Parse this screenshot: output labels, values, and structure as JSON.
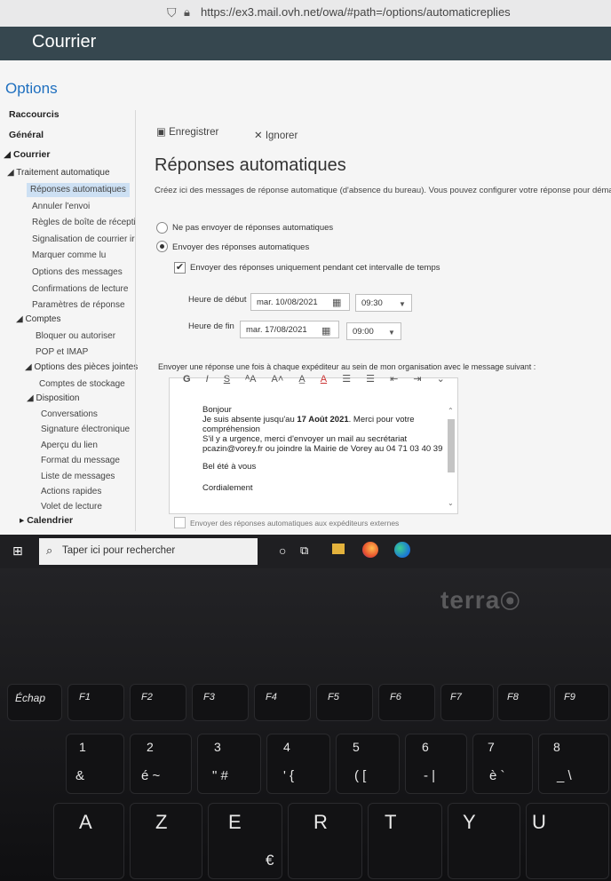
{
  "browser": {
    "url": "https://ex3.mail.ovh.net/owa/#path=/options/automaticreplies"
  },
  "header": {
    "app": "Courrier"
  },
  "options": {
    "title": "Options"
  },
  "nav": {
    "raccourcis": "Raccourcis",
    "general": "Général",
    "courrier": "Courrier",
    "traitement": "Traitement automatique",
    "reponses": "Réponses automatiques",
    "annuler": "Annuler l'envoi",
    "regles": "Règles de boîte de récepti",
    "signalisation": "Signalisation de courrier ir",
    "marquer": "Marquer comme lu",
    "options_messages": "Options des messages",
    "confirmations": "Confirmations de lecture",
    "parametres": "Paramètres de réponse",
    "comptes": "Comptes",
    "bloquer": "Bloquer ou autoriser",
    "pop": "POP et IMAP",
    "pieces": "Options des pièces jointes",
    "stockage": "Comptes de stockage",
    "disposition": "Disposition",
    "conversations": "Conversations",
    "signature": "Signature électronique",
    "apercu": "Aperçu du lien",
    "format": "Format du message",
    "liste": "Liste de messages",
    "actions": "Actions rapides",
    "volet": "Volet de lecture",
    "calendrier": "Calendrier"
  },
  "toolbar": {
    "save": "Enregistrer",
    "discard": "Ignorer"
  },
  "content": {
    "title": "Réponses automatiques",
    "intro": "Créez ici des messages de réponse automatique (d'absence du bureau). Vous pouvez configurer votre réponse pour déma",
    "radio_off": "Ne pas envoyer de réponses automatiques",
    "radio_on": "Envoyer des réponses automatiques",
    "interval": "Envoyer des réponses uniquement pendant cet intervalle de temps",
    "start_label": "Heure de début",
    "start_date": "mar. 10/08/2021",
    "start_time": "09:30",
    "end_label": "Heure de fin",
    "end_date": "mar. 17/08/2021",
    "end_time": "09:00",
    "org_label": "Envoyer une réponse une fois à chaque expéditeur au sein de mon organisation avec le message suivant :",
    "external": "Envoyer des réponses automatiques aux expéditeurs externes"
  },
  "editor": {
    "tools": [
      "G",
      "I",
      "S",
      "ᴬA",
      "A˄",
      "A̲",
      "A",
      "☰",
      "☰",
      "⇤",
      "⇥",
      "⌄"
    ],
    "lines": {
      "l1": "Bonjour",
      "l2a": "Je suis absente jusqu'au ",
      "l2b": "17 Août 2021",
      "l2c": ". Merci pour votre",
      "l3": "compréhension",
      "l4": "S'il y a urgence, merci d'envoyer un mail au secrétariat",
      "l5": "pcazin@vorey.fr ou joindre la Mairie de Vorey au 04 71 03 40 39",
      "l6": "Bel été à vous",
      "l7": "Cordialement"
    }
  },
  "taskbar": {
    "search": "Taper ici pour rechercher"
  },
  "laptop": {
    "brand": "terra"
  },
  "keyboard": {
    "fn": [
      "Échap",
      "F1",
      "F2",
      "F3",
      "F4",
      "F5",
      "F6",
      "F7",
      "F8",
      "F9"
    ],
    "num_top": [
      "1",
      "2",
      "3",
      "4",
      "5",
      "6",
      "7",
      "8"
    ],
    "num_bot": [
      "&",
      "é ~",
      "\" #",
      "' {",
      "( [",
      "- |",
      "è `",
      "_ \\"
    ],
    "alpha": [
      "A",
      "Z",
      "E",
      "R",
      "T",
      "Y",
      "U"
    ],
    "euro": "€"
  },
  "colors": {
    "accent": "#1e6fbf",
    "header": "#36474f",
    "selection": "#cde0f3"
  }
}
